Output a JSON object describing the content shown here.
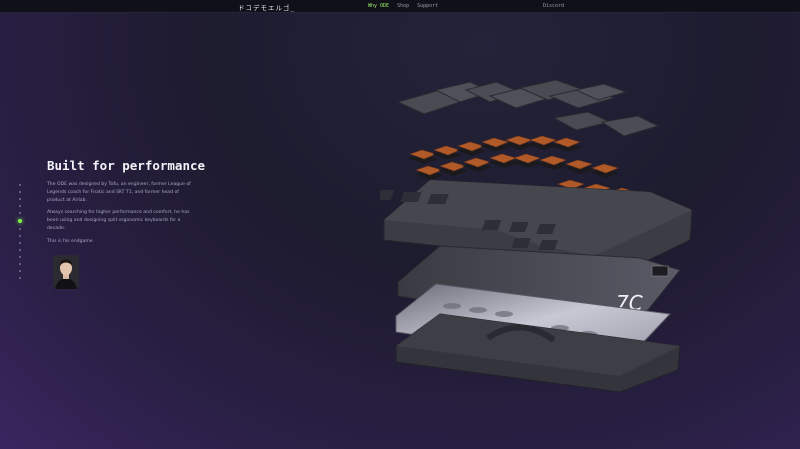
{
  "header": {
    "logo": "ドコデモエルゴ_",
    "nav": [
      {
        "label": "Why ODE",
        "active": true
      },
      {
        "label": "Shop",
        "active": false
      },
      {
        "label": "Support",
        "active": false
      }
    ],
    "discord": "Discord"
  },
  "section": {
    "title": "Built for performance",
    "paragraphs": [
      "The ODE was designed by Tofu, an engineer, former League of Legends coach for Fnatic and SKT T1, and former head of product at Airlab.",
      "Always searching for higher performance and comfort, he has been using and designing split ergonomic keyboards for a decade.",
      "This is his endgame"
    ]
  },
  "pager": {
    "count": 14,
    "active_index": 5
  },
  "colors": {
    "accent": "#7cf24a",
    "background": "#1d1b2e",
    "keycap": "#4a4a52",
    "switch": "#b05a2a",
    "plate": "#8e8e9c"
  },
  "icons": {
    "avatar": "person-portrait-icon",
    "keyboard": "exploded-keyboard-illustration"
  }
}
